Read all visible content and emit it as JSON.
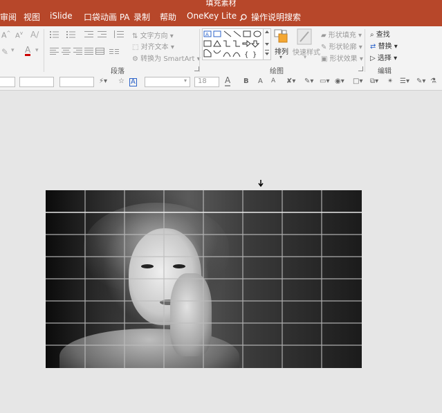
{
  "window": {
    "title": "填充素材"
  },
  "tabs": [
    {
      "label": "审阅"
    },
    {
      "label": "视图"
    },
    {
      "label": "iSlide"
    },
    {
      "label": "口袋动画 PA"
    },
    {
      "label": "录制"
    },
    {
      "label": "帮助"
    },
    {
      "label": "OneKey Lite"
    }
  ],
  "tell_me": {
    "label": "操作说明搜索"
  },
  "ribbon": {
    "paragraph": {
      "group_label": "段落",
      "text_direction": "文字方向",
      "align_text": "对齐文本",
      "convert_smartart": "转换为 SmartArt"
    },
    "drawing": {
      "group_label": "绘图",
      "arrange": "排列",
      "quick_styles": "快速样式",
      "shape_fill": "形状填充",
      "shape_outline": "形状轮廓",
      "shape_effects": "形状效果"
    },
    "editing": {
      "group_label": "编辑",
      "find": "查找",
      "replace": "替换",
      "select": "选择"
    }
  },
  "format_bar": {
    "font_size": "18",
    "bold": "B",
    "font_grow": "A",
    "font_shrink": "A",
    "font_color": "A"
  }
}
